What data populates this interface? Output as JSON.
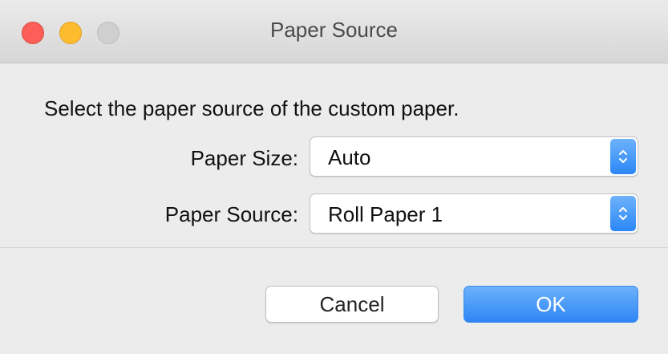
{
  "window": {
    "title": "Paper Source",
    "controls": {
      "close_icon": "close-icon",
      "minimize_icon": "minimize-icon",
      "zoom_icon": "zoom-icon",
      "close_color": "#fc5f57",
      "minimize_color": "#fdbc2e",
      "zoom_color": "#cfcfcf"
    }
  },
  "dialog": {
    "instruction": "Select the paper source of the custom paper.",
    "paper_size": {
      "label": "Paper Size:",
      "value": "Auto"
    },
    "paper_source": {
      "label": "Paper Source:",
      "value": "Roll Paper 1"
    }
  },
  "buttons": {
    "cancel_label": "Cancel",
    "ok_label": "OK",
    "accent_color": "#2f86f5"
  }
}
